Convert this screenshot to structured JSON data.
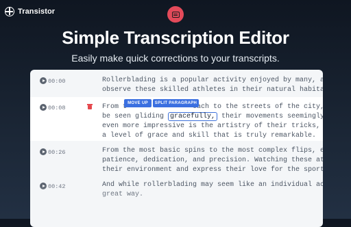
{
  "brand": {
    "name": "Transistor"
  },
  "hero": {
    "title": "Simple Transcription Editor",
    "subtitle": "Easily make quick corrections to your transcripts."
  },
  "toolbar": {
    "move_up_label": "MOVE UP",
    "split_paragraph_label": "SPLIT PARAGRAPH"
  },
  "paragraphs": [
    {
      "time": "00:00",
      "lines": [
        "Rollerblading is a popular activity enjoyed by many, and it's",
        "observe these skilled athletes in their natural habitat."
      ]
    },
    {
      "time": "00:08",
      "lines": [
        "From t",
        "each to the streets of the city, r",
        "be seen gliding ",
        "gracefully,",
        " their movements seemingly effortle",
        "even more impressive is the artistry of their tricks, which t",
        "a level of grace and skill that is truly remarkable."
      ]
    },
    {
      "time": "00:26",
      "lines": [
        "From the most basic spins to the most complex flips, each tric",
        "patience, dedication, and precision. Watching these athletes a",
        "their environment and express their love for the sport is an i"
      ]
    },
    {
      "time": "00:42",
      "lines": [
        "And while rollerblading may seem like an individual activity,",
        "great way."
      ]
    }
  ],
  "colors": {
    "accent": "#3a6fe0",
    "delete": "#e5484d",
    "app_icon": "#e34a5a"
  }
}
